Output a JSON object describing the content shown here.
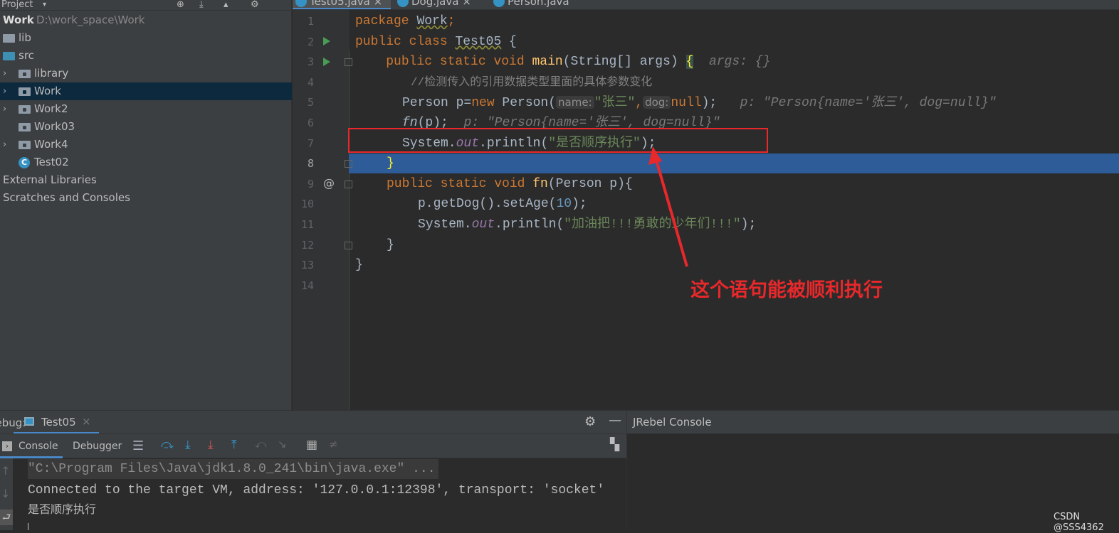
{
  "project": {
    "header": "Project",
    "root_name": "Work",
    "root_path": "D:\\work_space\\Work",
    "items": [
      {
        "label": "lib",
        "icon": "folder"
      },
      {
        "label": "src",
        "icon": "source-folder"
      },
      {
        "label": "library",
        "icon": "package-folder"
      },
      {
        "label": "Work",
        "icon": "package-folder",
        "selected": true
      },
      {
        "label": "Work2",
        "icon": "package-folder"
      },
      {
        "label": "Work03",
        "icon": "package-folder"
      },
      {
        "label": "Work4",
        "icon": "package-folder"
      },
      {
        "label": "Test02",
        "icon": "java-class"
      }
    ],
    "external": "External Libraries",
    "scratches": "Scratches and Consoles"
  },
  "tabs": [
    {
      "label": "Test05.java",
      "active": true
    },
    {
      "label": "Dog.java"
    },
    {
      "label": "Person.java"
    }
  ],
  "code": {
    "line_numbers": [
      "1",
      "2",
      "3",
      "4",
      "5",
      "6",
      "7",
      "8",
      "9",
      "10",
      "11",
      "12",
      "13",
      "14"
    ],
    "l1": {
      "kw": "package",
      "pkg": "Work",
      "end": ";"
    },
    "l2": {
      "kw": "public class",
      "name": "Test05",
      "end": " {"
    },
    "l3": {
      "kw": "public static void",
      "fn": "main",
      "params": "(String[] args) ",
      "brace": "{",
      "hint": "args: {}"
    },
    "l4": "//检测传入的引用数据类型里面的具体参数变化",
    "l5": {
      "a": "Person p=",
      "kw": "new",
      "b": " Person(",
      "h1": "name:",
      "s1": "\"张三\"",
      "c": ",",
      "h2": "dog:",
      "kw2": "null",
      "d": ");",
      "hint": "p: \"Person{name='张三', dog=null}\""
    },
    "l6": {
      "fn": "fn",
      "a": "(p);",
      "hint": "p: \"Person{name='张三', dog=null}\""
    },
    "l7": {
      "a": "System.",
      "out": "out",
      "b": ".println(",
      "s": "\"是否顺序执行\"",
      "c": ");"
    },
    "l8": "}",
    "l9": {
      "kw": "public static void",
      "fn": "fn",
      "a": "(Person p){"
    },
    "l10": {
      "a": "p.getDog().setAge(",
      "n": "10",
      "b": ");"
    },
    "l11": {
      "a": "System.",
      "out": "out",
      "b": ".println(",
      "s": "\"加油把!!!勇敢的少年们!!!\"",
      "c": ");"
    },
    "l12": "}",
    "l13": "}"
  },
  "annotation": {
    "text": "这个语句能被顺利执行",
    "color": "#e8282b"
  },
  "debug": {
    "label": "Debug:",
    "tab": "Test05",
    "console_tab": "Console",
    "debugger_tab": "Debugger",
    "console": [
      "\"C:\\Program Files\\Java\\jdk1.8.0_241\\bin\\java.exe\" ...",
      "Connected to the target VM, address: '127.0.0.1:12398', transport: 'socket'",
      "是否顺序执行"
    ]
  },
  "jrebel": {
    "title": "JRebel Console"
  },
  "watermark": "CSDN @SSS4362",
  "colors": {
    "highlight_line": "#2d5c99",
    "keyword": "#cc7832",
    "string": "#6a8759"
  }
}
